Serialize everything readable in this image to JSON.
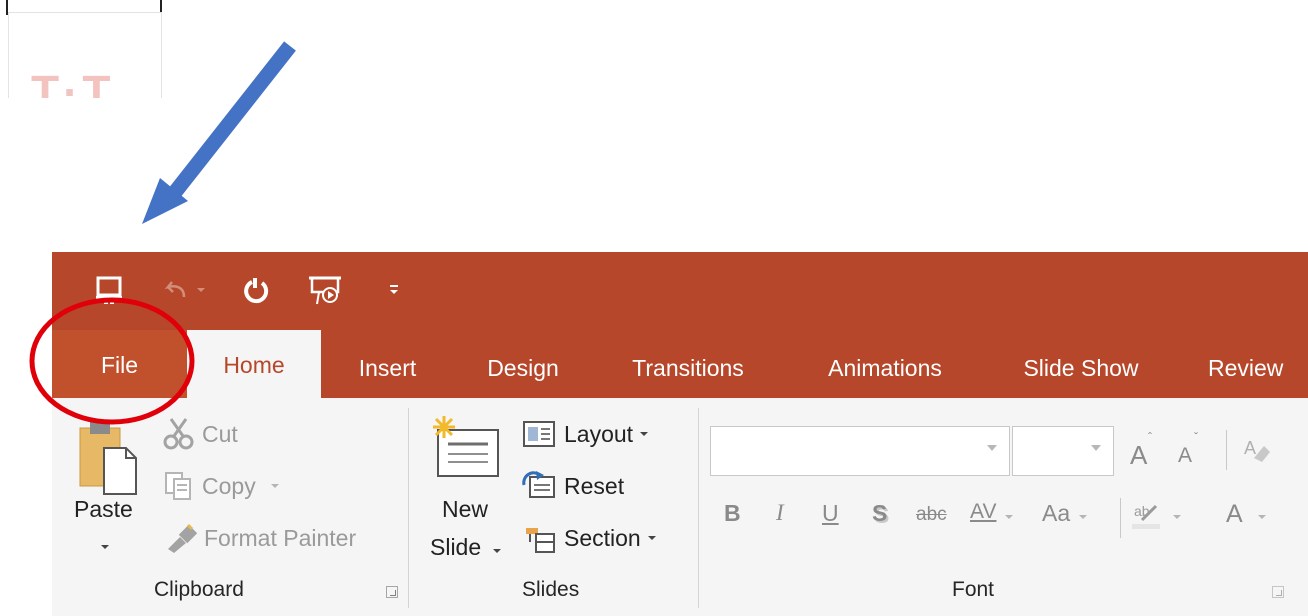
{
  "qat": {
    "icons": [
      "save-icon",
      "undo-icon",
      "redo-icon",
      "start-from-beginning-icon",
      "customize-qat-icon"
    ]
  },
  "tabs": [
    {
      "label": "File"
    },
    {
      "label": "Home"
    },
    {
      "label": "Insert"
    },
    {
      "label": "Design"
    },
    {
      "label": "Transitions"
    },
    {
      "label": "Animations"
    },
    {
      "label": "Slide Show"
    },
    {
      "label": "Review"
    }
  ],
  "clipboard": {
    "paste": "Paste",
    "cut": "Cut",
    "copy": "Copy",
    "format_painter": "Format Painter",
    "label": "Clipboard"
  },
  "slides": {
    "new_slide_line1": "New",
    "new_slide_line2": "Slide",
    "layout": "Layout",
    "reset": "Reset",
    "section": "Section",
    "label": "Slides"
  },
  "font": {
    "font_name_value": "",
    "font_size_value": "",
    "grow": "A",
    "shrink": "A",
    "bold": "B",
    "italic": "I",
    "underline": "U",
    "shadow": "S",
    "strikethrough": "abc",
    "spacing": "AV",
    "change_case": "Aa",
    "font_color": "A",
    "label": "Font"
  },
  "annotation": {
    "arrow_color": "#4472c4",
    "circle_color": "#e0000a"
  },
  "colors": {
    "ribbon": "#b7472a",
    "file_tab": "#c1502d",
    "panel": "#f5f5f5"
  }
}
